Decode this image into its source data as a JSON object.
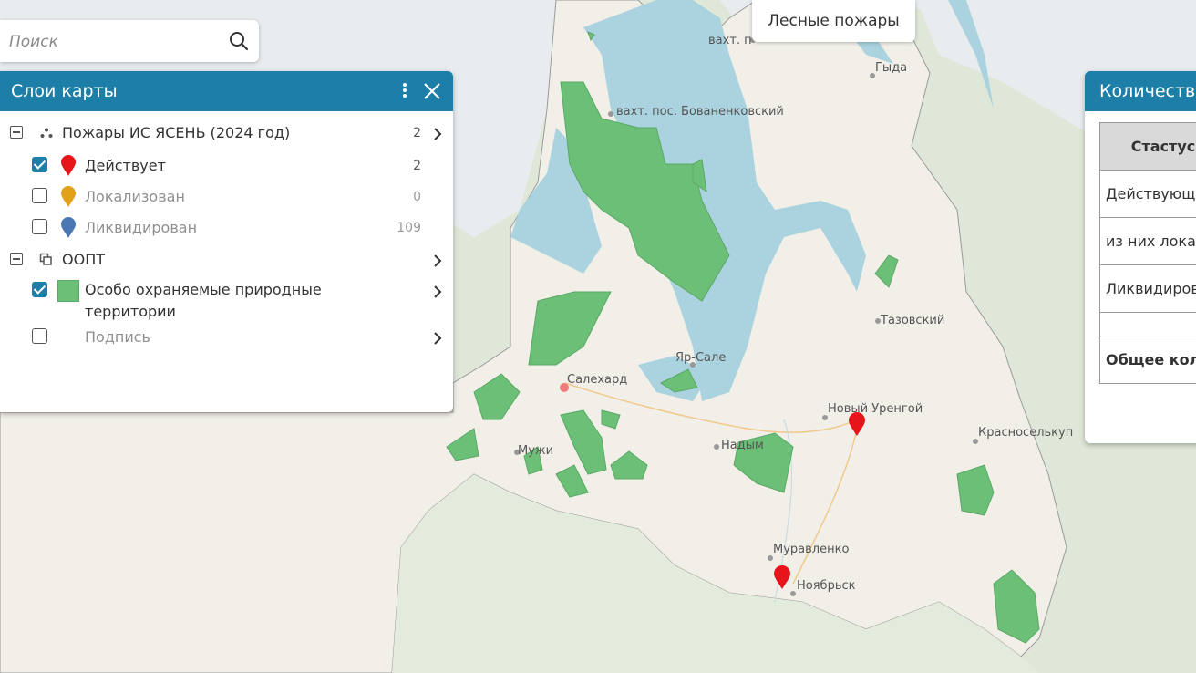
{
  "search": {
    "placeholder": "Поиск"
  },
  "map_title": "Лесные пожары",
  "layers_panel": {
    "title": "Слои карты",
    "groups": [
      {
        "label": "Пожары ИС ЯСЕНЬ (2024 год)",
        "count": "2"
      },
      {
        "label": "ООПТ"
      }
    ],
    "items": [
      {
        "label": "Действует",
        "count": "2",
        "checked": true
      },
      {
        "label": "Локализован",
        "count": "0",
        "checked": false
      },
      {
        "label": "Ликвидирован",
        "count": "109",
        "checked": false
      },
      {
        "label_line1": "Особо охраняемые природные",
        "label_line2": "территории",
        "checked": true
      },
      {
        "label": "Подпись",
        "checked": false
      }
    ]
  },
  "count_panel": {
    "title": "Количество",
    "header": "Стастус",
    "rows": [
      "Действующи",
      "из них локал",
      "Ликвидирова",
      "",
      "Общее коли"
    ]
  },
  "places": {
    "vakht1": "вахт. п",
    "gyda": "Гыда",
    "bovanenkovsky": "вахт. пос. Бованенковский",
    "tazovsky": "Тазовский",
    "yar_sale": "Яр-Сале",
    "salekhard": "Салехард",
    "novy_urengoy": "Новый Уренгой",
    "nadym": "Надым",
    "krasnoselkup": "Красноселькуп",
    "muzhi": "Мужи",
    "muravlenko": "Муравленко",
    "noyabrsk": "Ноябрьск"
  },
  "colors": {
    "header": "#1d7fa7",
    "protected_area": "#6cbf76",
    "water": "#aad3df",
    "land": "#f2efe9",
    "fire_active": "#e8141b",
    "fire_localized": "#e3a11a",
    "fire_liquidated": "#4a78b5"
  },
  "icons": [
    "search-icon",
    "kebab-menu-icon",
    "close-icon",
    "chevron-right-icon",
    "marker-icon",
    "points-icon",
    "layers-icon"
  ]
}
